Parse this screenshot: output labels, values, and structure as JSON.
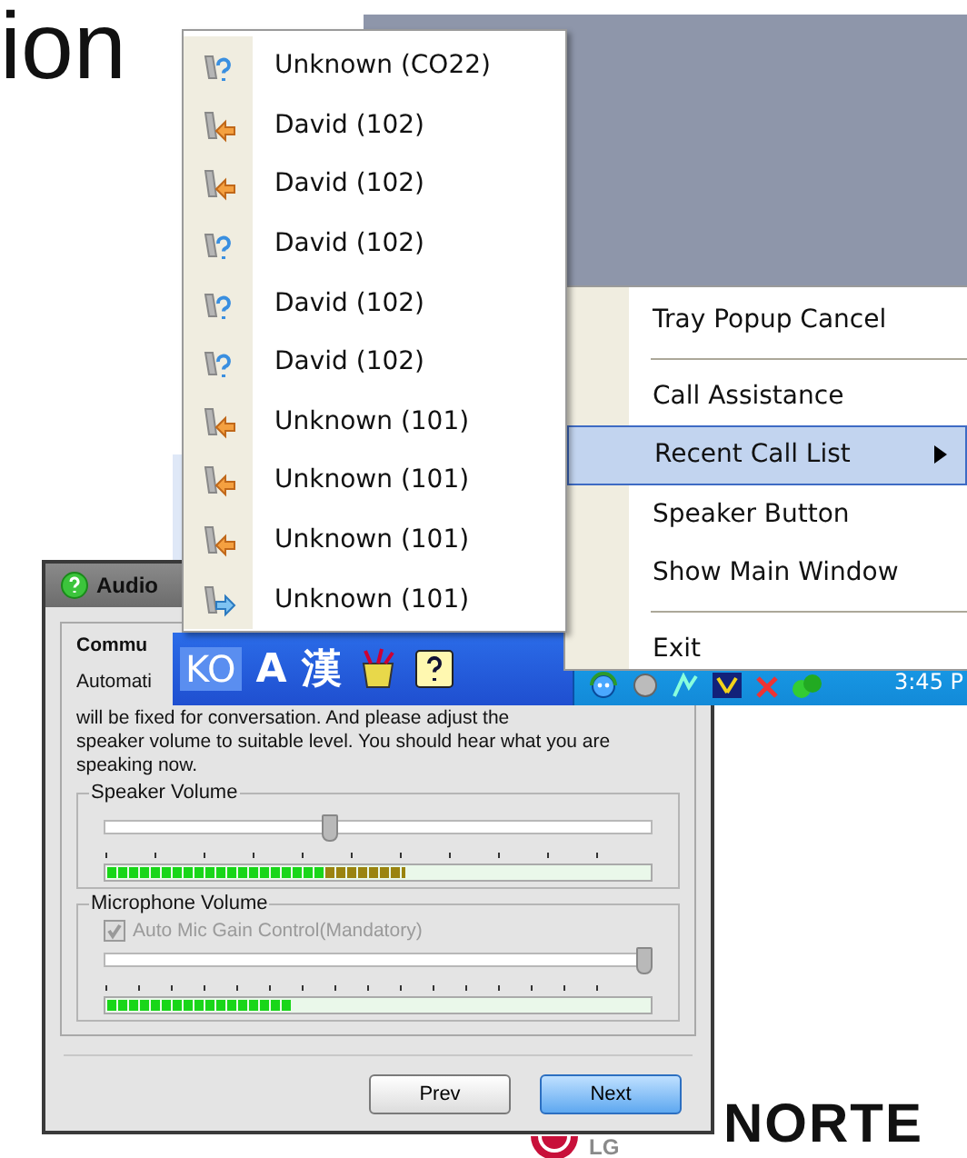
{
  "slide": {
    "title_fragment": "ion"
  },
  "dialog": {
    "title": "Audio",
    "group": "Commu",
    "intro_cut": "Automati",
    "intro_line": "will be fixed for conversation. And please adjust the",
    "intro_rest": "speaker volume to suitable level. You should hear what you are speaking now.",
    "speaker": {
      "label": "Speaker Volume",
      "level": 0.41,
      "meter": {
        "level": 0.55
      }
    },
    "microphone": {
      "label": "Microphone Volume",
      "checkbox": {
        "label": "Auto Mic Gain Control(Mandatory)",
        "checked": true,
        "disabled": true
      },
      "level": 1.0,
      "meter": {
        "level": 0.34
      }
    },
    "buttons": [
      {
        "label": "Prev",
        "default": false
      },
      {
        "label": "Next",
        "default": true
      }
    ]
  },
  "taskbar": {
    "language": "KO",
    "input_mode": "A",
    "hanja": "漢",
    "clock": "3:45 P"
  },
  "recent_calls": [
    {
      "kind": "missed",
      "label": "Unknown (CO22)"
    },
    {
      "kind": "incoming",
      "label": "David (102)"
    },
    {
      "kind": "incoming",
      "label": "David (102)"
    },
    {
      "kind": "missed",
      "label": "David (102)"
    },
    {
      "kind": "missed",
      "label": "David (102)"
    },
    {
      "kind": "missed",
      "label": "David (102)"
    },
    {
      "kind": "incoming",
      "label": "Unknown (101)"
    },
    {
      "kind": "incoming",
      "label": "Unknown (101)"
    },
    {
      "kind": "incoming",
      "label": "Unknown (101)"
    },
    {
      "kind": "outgoing",
      "label": "Unknown (101)"
    }
  ],
  "tray_menu": [
    {
      "kind": "item",
      "label": "Tray Popup Cancel",
      "selected": false
    },
    {
      "kind": "separator"
    },
    {
      "kind": "item",
      "label": "Call Assistance",
      "selected": false
    },
    {
      "kind": "submenu",
      "label": "Recent Call List",
      "selected": true
    },
    {
      "kind": "item",
      "label": "Speaker Button",
      "selected": false
    },
    {
      "kind": "item",
      "label": "Show Main Window",
      "selected": false
    },
    {
      "kind": "separator"
    },
    {
      "kind": "item",
      "label": "Exit",
      "selected": false
    }
  ],
  "logo": {
    "brand": "LG",
    "partner": "NORTE"
  }
}
